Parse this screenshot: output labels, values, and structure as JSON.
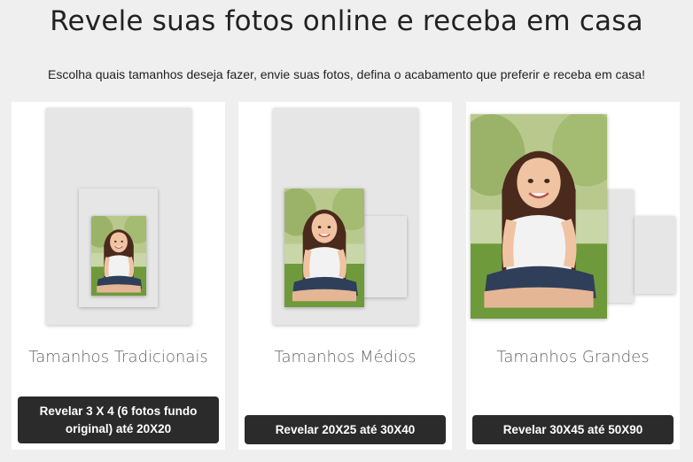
{
  "header": {
    "title": "Revele suas fotos online e receba em casa",
    "subtitle": "Escolha quais tamanhos deseja fazer, envie suas fotos, defina o acabamento que preferir e receba em casa!"
  },
  "cards": [
    {
      "title": "Tamanhos Tradicionais",
      "button": "Revelar 3 X 4 (6 fotos fundo original) até 20X20"
    },
    {
      "title": "Tamanhos Médios",
      "button": "Revelar 20X25 até 30X40"
    },
    {
      "title": "Tamanhos Grandes",
      "button": "Revelar 30X45 até 50X90"
    }
  ]
}
